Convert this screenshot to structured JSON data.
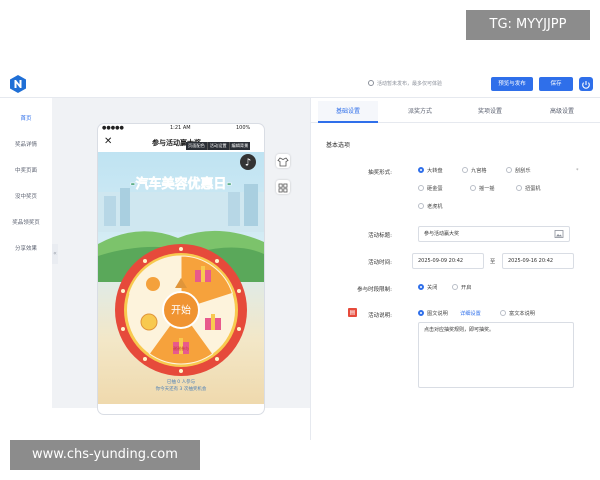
{
  "watermarks": {
    "top": "TG: MYYJJPP",
    "bottom": "www.chs-yunding.com"
  },
  "header": {
    "hint": "活动暂未发布，最多仅可体验",
    "publish_label": "预览与发布",
    "save_label": "保存"
  },
  "nav": {
    "items": [
      {
        "label": "首页",
        "active": true
      },
      {
        "label": "奖品详情",
        "active": false
      },
      {
        "label": "中奖页面",
        "active": false
      },
      {
        "label": "没中奖页",
        "active": false
      },
      {
        "label": "奖品领奖页",
        "active": false
      },
      {
        "label": "分享效果",
        "active": false
      }
    ]
  },
  "phone": {
    "status_carrier": "●●●●●",
    "status_time": "1:21 AM",
    "status_battery": "100%",
    "title": "参与活动赢大奖",
    "banner": "-汽车美容优惠日-",
    "start_label": "开始",
    "caption_line1": "已抽 0 人参与",
    "caption_line2": "你今天还有 3 次抽奖机会",
    "prize_label": "谢谢参与"
  },
  "context_toolbar": [
    "页面配色",
    "活动设置",
    "编辑背景"
  ],
  "panel": {
    "tabs": [
      "基础设置",
      "派奖方式",
      "奖项设置",
      "高级设置"
    ],
    "section_title": "基本选项",
    "form": {
      "type_label": "抽奖形式:",
      "type_options": [
        {
          "label": "大转盘",
          "checked": true
        },
        {
          "label": "九宫格",
          "checked": false
        },
        {
          "label": "刮刮乐",
          "checked": false
        },
        {
          "label": "砸金蛋",
          "checked": false
        },
        {
          "label": "摇一摇",
          "checked": false
        },
        {
          "label": "扭蛋机",
          "checked": false
        },
        {
          "label": "老虎机",
          "checked": false
        }
      ],
      "title_label": "活动标题:",
      "title_value": "参与活动赢大奖",
      "time_label": "活动时间:",
      "time_start": "2025-09-09 20:42",
      "time_sep": "至",
      "time_end": "2025-09-16 20:42",
      "limit_label": "参与时段限制:",
      "limit_options": [
        {
          "label": "关闭",
          "checked": true
        },
        {
          "label": "开启",
          "checked": false
        }
      ],
      "desc_label": "活动说明:",
      "desc_options": [
        {
          "label": "图文说明",
          "checked": true
        },
        {
          "label": "富文本说明",
          "checked": false
        }
      ],
      "desc_link": "详细设置",
      "desc_placeholder": "点击对应抽奖规则，即可抽奖。"
    }
  },
  "colors": {
    "accent": "#2f6fea",
    "wheel_red": "#e64a3b",
    "wheel_orange": "#f6a23c"
  }
}
